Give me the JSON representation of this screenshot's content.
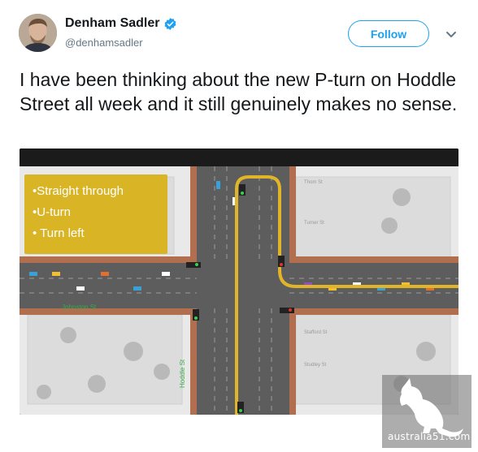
{
  "tweet": {
    "display_name": "Denham Sadler",
    "handle": "@denhamsadler",
    "follow_label": "Follow",
    "text": "I have been thinking about the new P-turn on Hoddle Street all week and it still genuinely makes no sense."
  },
  "icons": {
    "verified": "verified-badge-icon",
    "caret": "chevron-down-icon"
  },
  "colors": {
    "accent": "#1da1f2",
    "legend_bg": "#d9b526",
    "route": "#e0b628"
  },
  "map": {
    "legend_items": [
      "•Straight through",
      "•U-turn",
      "• Turn left"
    ],
    "street_cross": "Johnston St",
    "street_main": "Hoddle St",
    "minor_street_labels": [
      "Thom St",
      "Turner St",
      "Stafford St",
      "Studley St"
    ]
  },
  "watermark": {
    "text": "australia51.com"
  }
}
